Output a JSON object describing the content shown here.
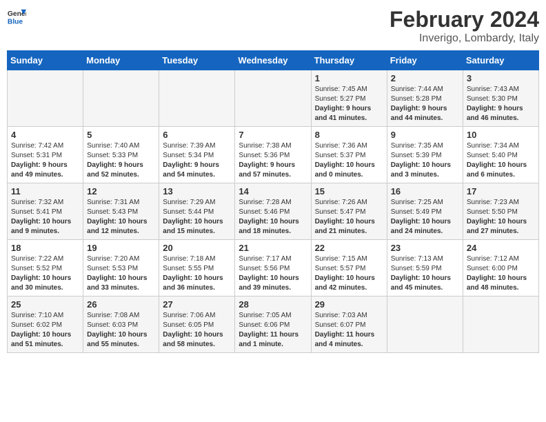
{
  "header": {
    "logo_general": "General",
    "logo_blue": "Blue",
    "title": "February 2024",
    "subtitle": "Inverigo, Lombardy, Italy"
  },
  "days_of_week": [
    "Sunday",
    "Monday",
    "Tuesday",
    "Wednesday",
    "Thursday",
    "Friday",
    "Saturday"
  ],
  "weeks": [
    [
      {
        "day": "",
        "sunrise": "",
        "sunset": "",
        "daylight": ""
      },
      {
        "day": "",
        "sunrise": "",
        "sunset": "",
        "daylight": ""
      },
      {
        "day": "",
        "sunrise": "",
        "sunset": "",
        "daylight": ""
      },
      {
        "day": "",
        "sunrise": "",
        "sunset": "",
        "daylight": ""
      },
      {
        "day": "1",
        "sunrise": "7:45 AM",
        "sunset": "5:27 PM",
        "daylight": "9 hours and 41 minutes."
      },
      {
        "day": "2",
        "sunrise": "7:44 AM",
        "sunset": "5:28 PM",
        "daylight": "9 hours and 44 minutes."
      },
      {
        "day": "3",
        "sunrise": "7:43 AM",
        "sunset": "5:30 PM",
        "daylight": "9 hours and 46 minutes."
      }
    ],
    [
      {
        "day": "4",
        "sunrise": "7:42 AM",
        "sunset": "5:31 PM",
        "daylight": "9 hours and 49 minutes."
      },
      {
        "day": "5",
        "sunrise": "7:40 AM",
        "sunset": "5:33 PM",
        "daylight": "9 hours and 52 minutes."
      },
      {
        "day": "6",
        "sunrise": "7:39 AM",
        "sunset": "5:34 PM",
        "daylight": "9 hours and 54 minutes."
      },
      {
        "day": "7",
        "sunrise": "7:38 AM",
        "sunset": "5:36 PM",
        "daylight": "9 hours and 57 minutes."
      },
      {
        "day": "8",
        "sunrise": "7:36 AM",
        "sunset": "5:37 PM",
        "daylight": "10 hours and 0 minutes."
      },
      {
        "day": "9",
        "sunrise": "7:35 AM",
        "sunset": "5:39 PM",
        "daylight": "10 hours and 3 minutes."
      },
      {
        "day": "10",
        "sunrise": "7:34 AM",
        "sunset": "5:40 PM",
        "daylight": "10 hours and 6 minutes."
      }
    ],
    [
      {
        "day": "11",
        "sunrise": "7:32 AM",
        "sunset": "5:41 PM",
        "daylight": "10 hours and 9 minutes."
      },
      {
        "day": "12",
        "sunrise": "7:31 AM",
        "sunset": "5:43 PM",
        "daylight": "10 hours and 12 minutes."
      },
      {
        "day": "13",
        "sunrise": "7:29 AM",
        "sunset": "5:44 PM",
        "daylight": "10 hours and 15 minutes."
      },
      {
        "day": "14",
        "sunrise": "7:28 AM",
        "sunset": "5:46 PM",
        "daylight": "10 hours and 18 minutes."
      },
      {
        "day": "15",
        "sunrise": "7:26 AM",
        "sunset": "5:47 PM",
        "daylight": "10 hours and 21 minutes."
      },
      {
        "day": "16",
        "sunrise": "7:25 AM",
        "sunset": "5:49 PM",
        "daylight": "10 hours and 24 minutes."
      },
      {
        "day": "17",
        "sunrise": "7:23 AM",
        "sunset": "5:50 PM",
        "daylight": "10 hours and 27 minutes."
      }
    ],
    [
      {
        "day": "18",
        "sunrise": "7:22 AM",
        "sunset": "5:52 PM",
        "daylight": "10 hours and 30 minutes."
      },
      {
        "day": "19",
        "sunrise": "7:20 AM",
        "sunset": "5:53 PM",
        "daylight": "10 hours and 33 minutes."
      },
      {
        "day": "20",
        "sunrise": "7:18 AM",
        "sunset": "5:55 PM",
        "daylight": "10 hours and 36 minutes."
      },
      {
        "day": "21",
        "sunrise": "7:17 AM",
        "sunset": "5:56 PM",
        "daylight": "10 hours and 39 minutes."
      },
      {
        "day": "22",
        "sunrise": "7:15 AM",
        "sunset": "5:57 PM",
        "daylight": "10 hours and 42 minutes."
      },
      {
        "day": "23",
        "sunrise": "7:13 AM",
        "sunset": "5:59 PM",
        "daylight": "10 hours and 45 minutes."
      },
      {
        "day": "24",
        "sunrise": "7:12 AM",
        "sunset": "6:00 PM",
        "daylight": "10 hours and 48 minutes."
      }
    ],
    [
      {
        "day": "25",
        "sunrise": "7:10 AM",
        "sunset": "6:02 PM",
        "daylight": "10 hours and 51 minutes."
      },
      {
        "day": "26",
        "sunrise": "7:08 AM",
        "sunset": "6:03 PM",
        "daylight": "10 hours and 55 minutes."
      },
      {
        "day": "27",
        "sunrise": "7:06 AM",
        "sunset": "6:05 PM",
        "daylight": "10 hours and 58 minutes."
      },
      {
        "day": "28",
        "sunrise": "7:05 AM",
        "sunset": "6:06 PM",
        "daylight": "11 hours and 1 minute."
      },
      {
        "day": "29",
        "sunrise": "7:03 AM",
        "sunset": "6:07 PM",
        "daylight": "11 hours and 4 minutes."
      },
      {
        "day": "",
        "sunrise": "",
        "sunset": "",
        "daylight": ""
      },
      {
        "day": "",
        "sunrise": "",
        "sunset": "",
        "daylight": ""
      }
    ]
  ]
}
